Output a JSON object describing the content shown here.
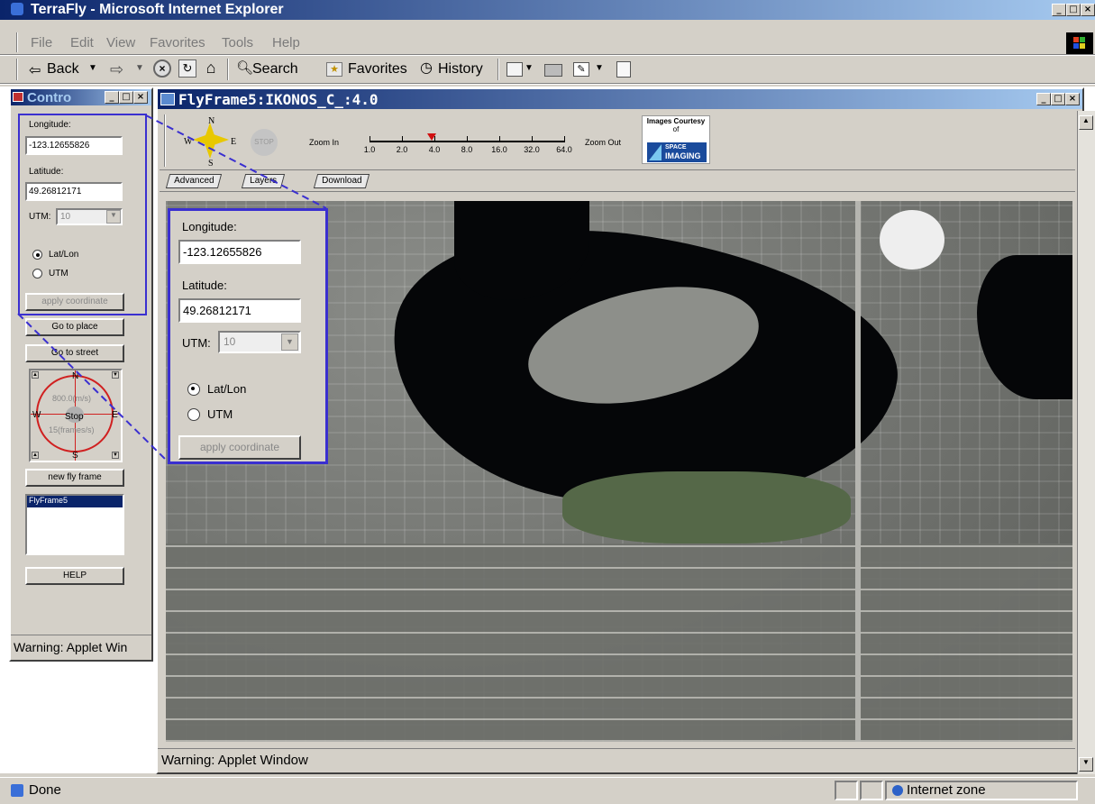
{
  "browser": {
    "title": "TerraFly - Microsoft Internet Explorer",
    "menu": [
      "File",
      "Edit",
      "View",
      "Favorites",
      "Tools",
      "Help"
    ],
    "toolbar": {
      "back": "Back",
      "search": "Search",
      "favorites": "Favorites",
      "history": "History"
    },
    "status": {
      "text": "Done",
      "zone": "Internet zone"
    }
  },
  "control_panel": {
    "title": "Contro",
    "longitude_label": "Longitude:",
    "longitude_value": "-123.12655826",
    "latitude_label": "Latitude:",
    "latitude_value": "49.26812171",
    "utm_label": "UTM:",
    "utm_value": "10",
    "radio_latlon": "Lat/Lon",
    "radio_utm": "UTM",
    "apply_btn": "apply coordinate",
    "goto_place": "Go to place",
    "goto_street": "Go to street",
    "compass": {
      "n": "N",
      "s": "S",
      "e": "E",
      "w": "W",
      "stop": "Stop",
      "speed": "800.0(m/s)",
      "rate": "15(frames/s)"
    },
    "new_frame": "new fly frame",
    "frames": [
      "FlyFrame5"
    ],
    "help": "HELP",
    "warning": "Warning: Applet Win"
  },
  "zoom_callout": {
    "longitude_label": "Longitude:",
    "longitude_value": "-123.12655826",
    "latitude_label": "Latitude:",
    "latitude_value": "49.26812171",
    "utm_label": "UTM:",
    "utm_value": "10",
    "radio_latlon": "Lat/Lon",
    "radio_utm": "UTM",
    "apply_btn": "apply coordinate"
  },
  "fly_frame": {
    "title": "FlyFrame5:IKONOS_C_:4.0",
    "compass": {
      "n": "N",
      "s": "S",
      "e": "E",
      "w": "W"
    },
    "stop": "STOP",
    "zoom_in": "Zoom In",
    "zoom_out": "Zoom Out",
    "zoom_ticks": [
      "1.0",
      "2.0",
      "4.0",
      "8.0",
      "16.0",
      "32.0",
      "64.0"
    ],
    "zoom_selected": "4.0",
    "courtesy_line1": "Images Courtesy",
    "courtesy_line2": "of",
    "courtesy_logo1": "SPACE",
    "courtesy_logo2": "IMAGING",
    "tabs": [
      "Advanced",
      "Layers",
      "Download"
    ],
    "warning": "Warning: Applet Window"
  },
  "colors": {
    "title_active": "#0a246a",
    "callout_border": "#3a2fd0",
    "compass_red": "#d02020"
  }
}
